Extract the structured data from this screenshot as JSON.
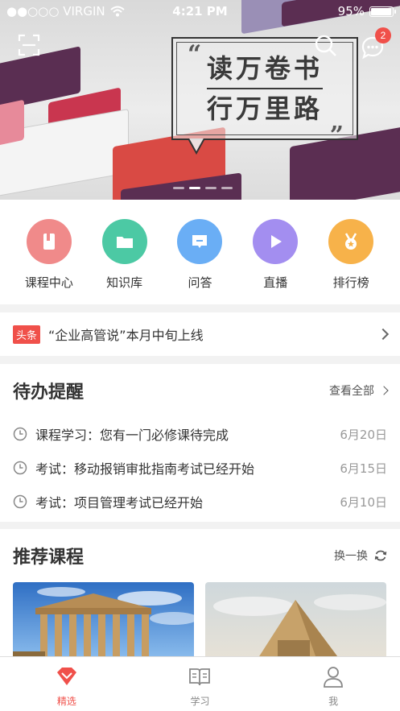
{
  "status_bar": {
    "carrier": "●●○○○ VIRGIN",
    "time": "4:21 PM",
    "battery": "95%",
    "battery_level": 0.95
  },
  "banner": {
    "line1": "读万卷书",
    "line2": "行万里路",
    "open_quote": "“",
    "close_quote": "”",
    "message_badge": "2",
    "slides": 4,
    "active_slide": 1
  },
  "quick_entries": [
    {
      "label": "课程中心",
      "icon": "book-icon",
      "color": "#f08a8a"
    },
    {
      "label": "知识库",
      "icon": "folder-icon",
      "color": "#4cc9a4"
    },
    {
      "label": "问答",
      "icon": "chat-icon",
      "color": "#6aaef5"
    },
    {
      "label": "直播",
      "icon": "play-icon",
      "color": "#a38ef0"
    },
    {
      "label": "排行榜",
      "icon": "medal-icon",
      "color": "#f7b24a"
    }
  ],
  "headline": {
    "tag": "头条",
    "text": "“企业高管说”本月中旬上线"
  },
  "todo": {
    "title": "待办提醒",
    "view_all": "查看全部",
    "items": [
      {
        "text": "课程学习：您有一门必修课待完成",
        "date": "6月20日"
      },
      {
        "text": "考试：移动报销审批指南考试已经开始",
        "date": "6月15日"
      },
      {
        "text": "考试：项目管理考试已经开始",
        "date": "6月10日"
      }
    ]
  },
  "recommend": {
    "title": "推荐课程",
    "refresh": "换一换",
    "cards": [
      {
        "image": "parthenon-photo"
      },
      {
        "image": "pyramid-photo"
      }
    ]
  },
  "tabs": [
    {
      "label": "精选",
      "icon": "gem-icon",
      "active": true
    },
    {
      "label": "学习",
      "icon": "open-book-icon",
      "active": false
    },
    {
      "label": "我",
      "icon": "person-icon",
      "active": false
    }
  ],
  "colors": {
    "accent": "#f0504a"
  }
}
